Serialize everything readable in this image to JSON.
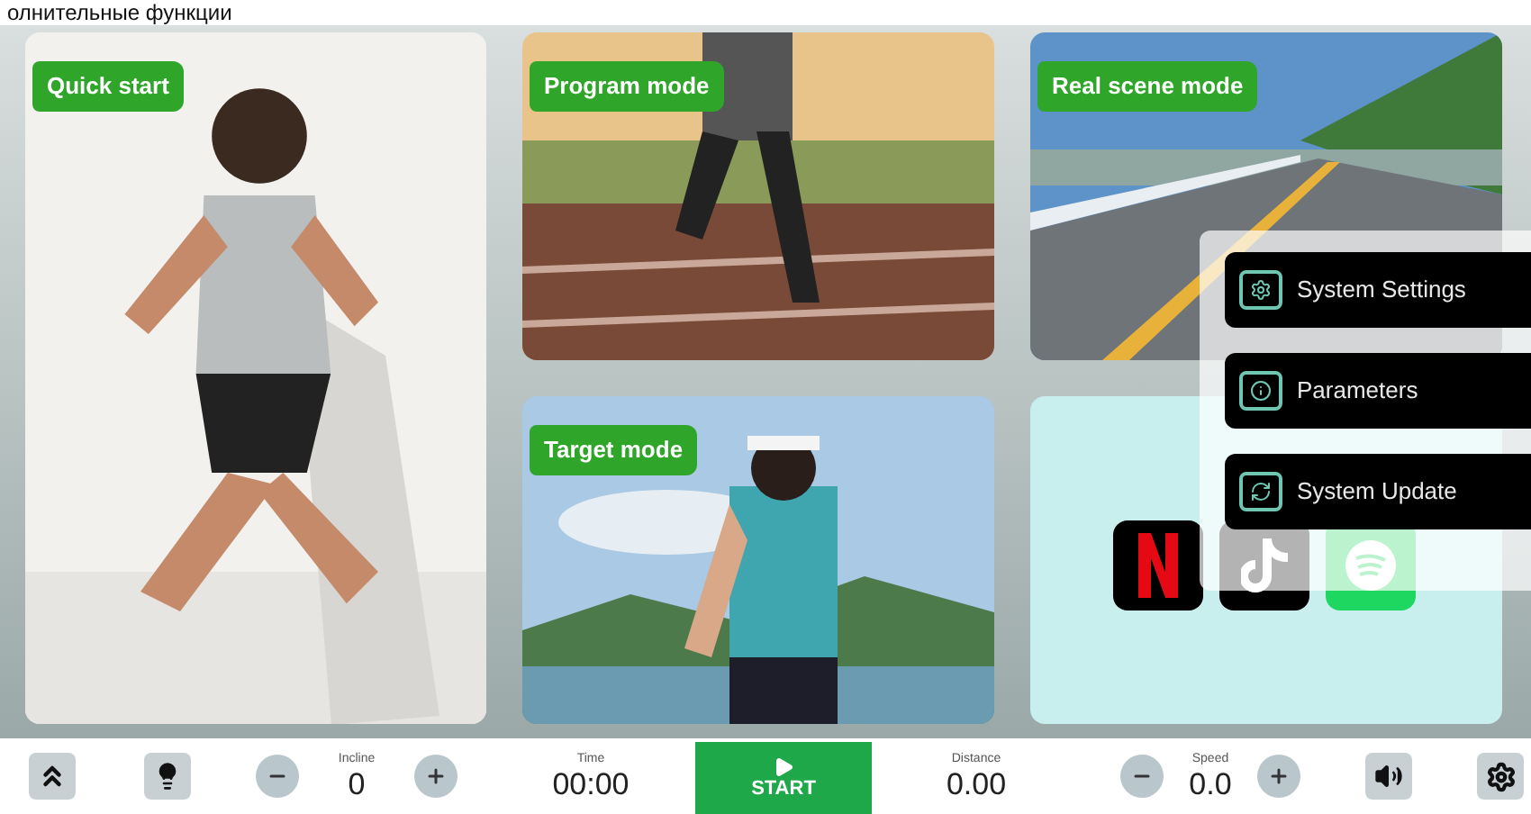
{
  "header_text": "олнительные функции",
  "cards": [
    {
      "title": "Quick start",
      "kind": "runner"
    },
    {
      "title": "Program mode",
      "kind": "track"
    },
    {
      "title": "Real scene mode",
      "kind": "road"
    },
    {
      "title": "Target mode",
      "kind": "lake"
    }
  ],
  "apps": [
    {
      "kind": "video"
    },
    {
      "kind": "note"
    },
    {
      "kind": "music"
    }
  ],
  "menu": [
    {
      "label": "System Settings",
      "kind": "settings"
    },
    {
      "label": "Parameters",
      "kind": "info"
    },
    {
      "label": "System Update",
      "kind": "update"
    }
  ],
  "bottom_bar": {
    "incline": {
      "label": "Incline",
      "value": "0"
    },
    "time": {
      "label": "Time",
      "value": "00:00"
    },
    "start": {
      "label": "START"
    },
    "distance": {
      "label": "Distance",
      "value": "0.00"
    },
    "speed": {
      "label": "Speed",
      "value": "0.0"
    }
  }
}
